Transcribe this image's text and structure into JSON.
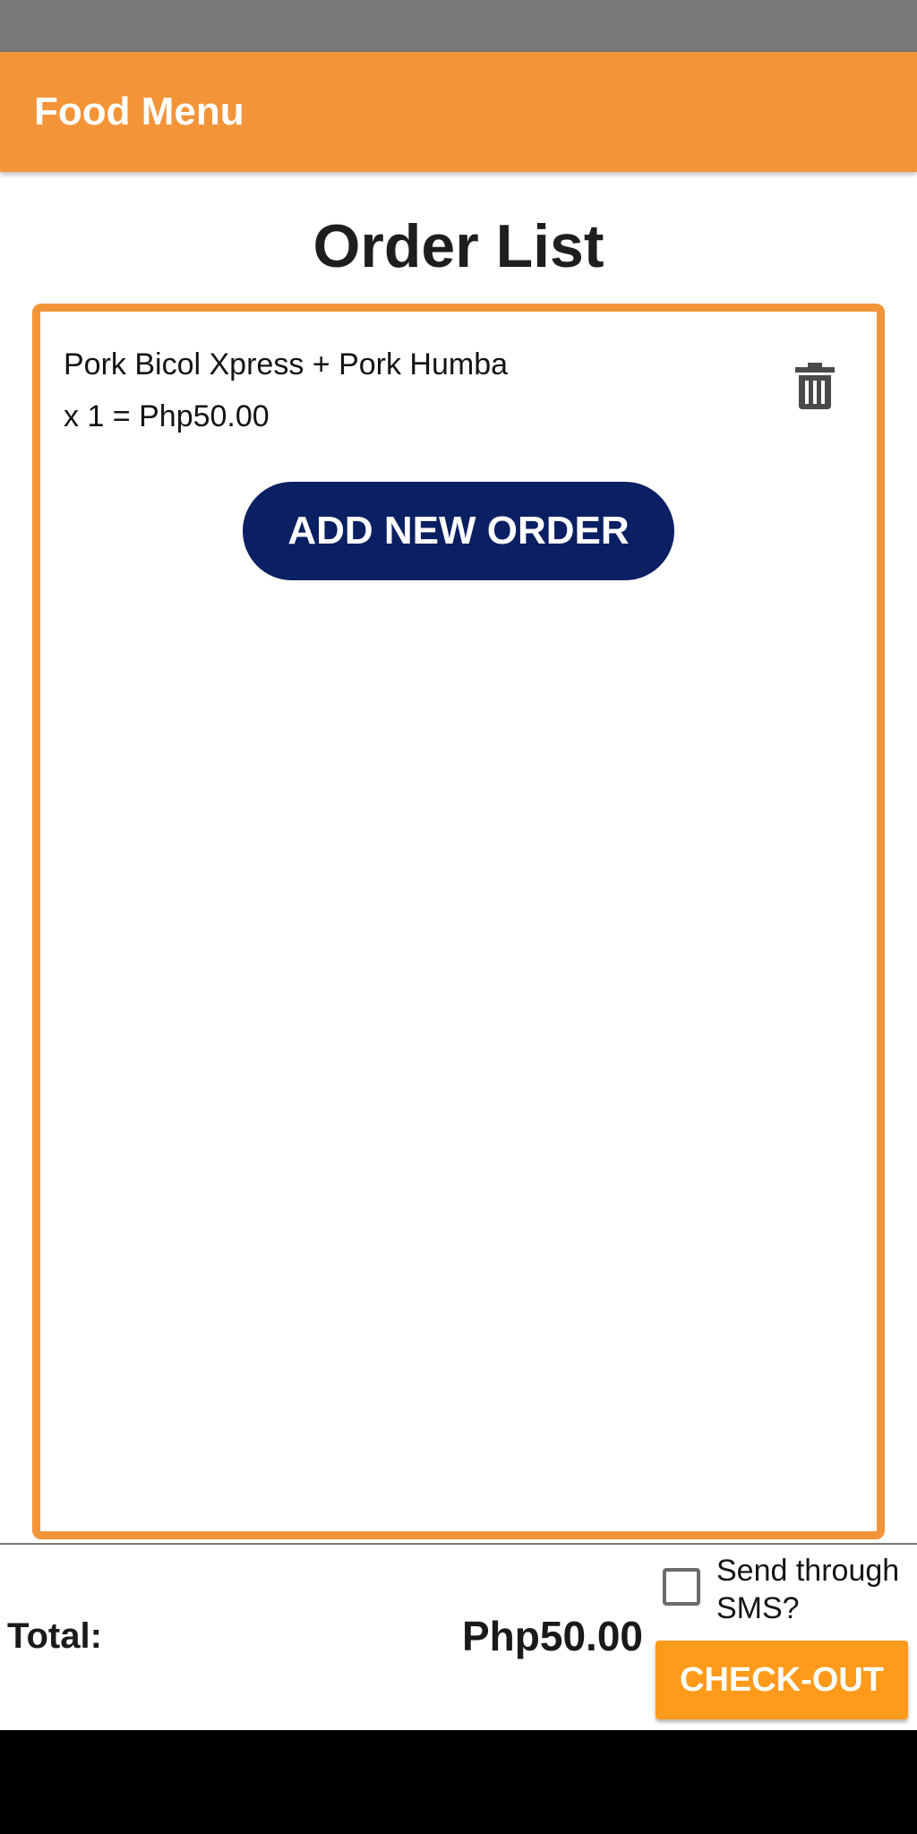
{
  "app_bar": {
    "title": "Food Menu",
    "color": "#f39439"
  },
  "page": {
    "title": "Order List"
  },
  "orders": [
    {
      "name": "Pork Bicol Xpress + Pork Humba",
      "detail": "x 1 = Php50.00",
      "delete_icon": "trash-icon"
    }
  ],
  "actions": {
    "add_order_label": "ADD NEW ORDER",
    "add_order_color": "#0b1f63"
  },
  "footer": {
    "total_label": "Total:",
    "total_value": "Php50.00",
    "sms_label": "Send through SMS?",
    "sms_checked": false,
    "checkout_label": "CHECK-OUT",
    "checkout_color": "#ff9a1a"
  }
}
